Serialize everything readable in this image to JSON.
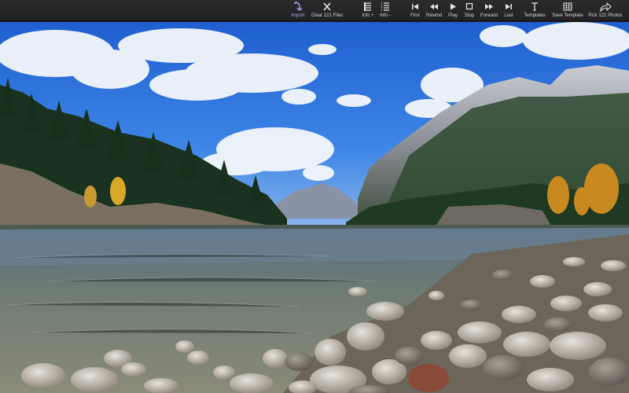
{
  "toolbar": {
    "import": "Import",
    "clear": "Clear 121 Files",
    "info_plus": "Info +",
    "info_minus": "Info -",
    "first": "First",
    "rewind": "Rewind",
    "play": "Play",
    "stop": "Stop",
    "forward": "Forward",
    "last": "Last",
    "templates": "Templates",
    "save_template": "Save Template",
    "pick": "Pick 121 Photos"
  },
  "colors": {
    "accent": "#9b7ff0",
    "toolbar_bg": "#232325",
    "icon": "#e6e6ea"
  }
}
